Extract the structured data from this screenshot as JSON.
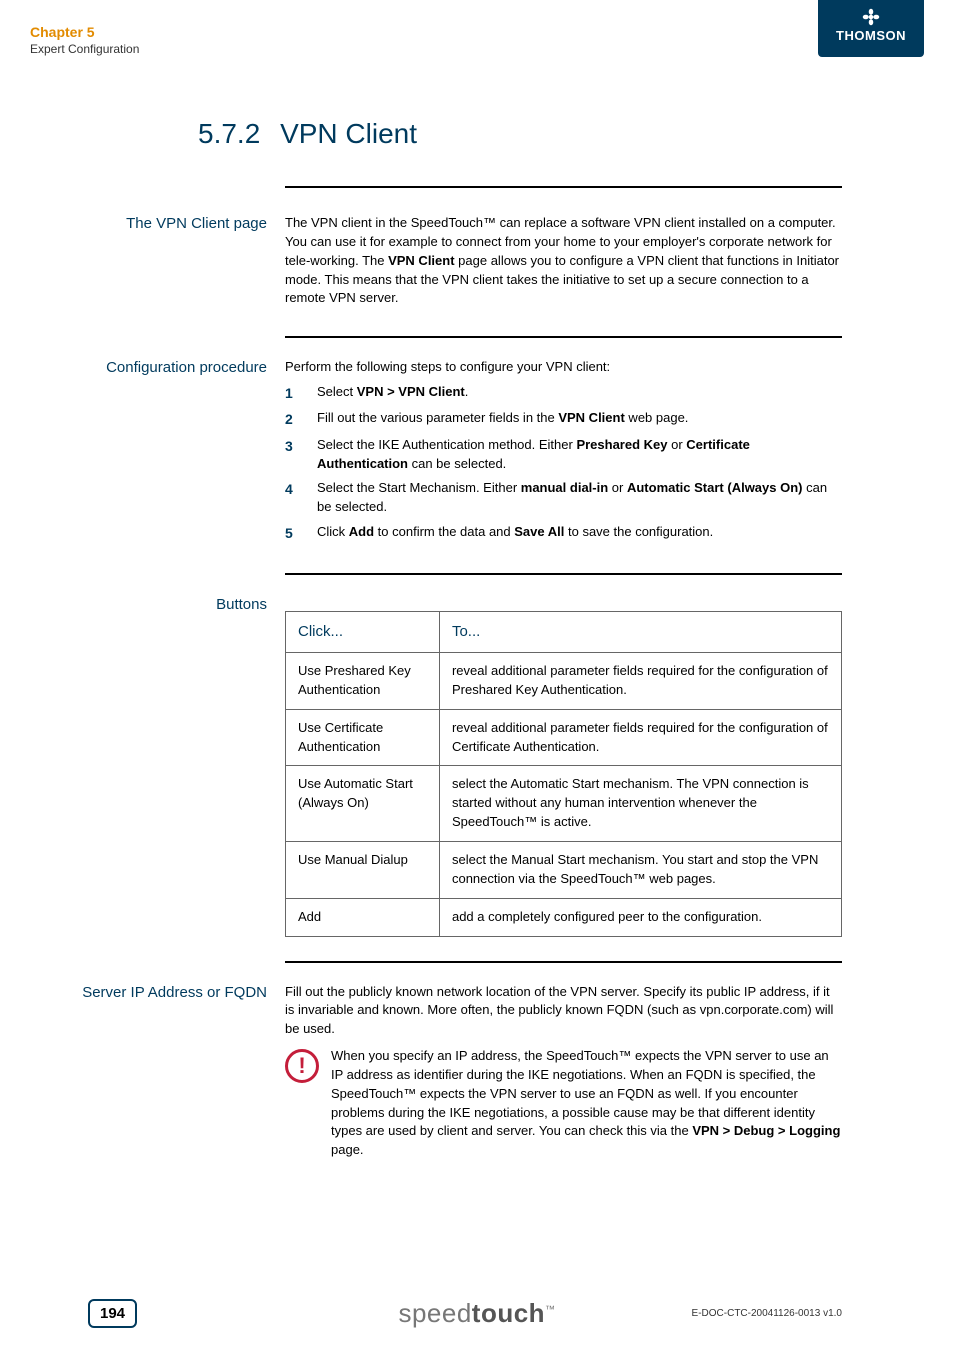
{
  "header": {
    "chapter": "Chapter 5",
    "subtitle": "Expert Configuration",
    "brand": "THOMSON"
  },
  "title": {
    "number": "5.7.2",
    "text": "VPN Client"
  },
  "sections": {
    "vpn_page": {
      "label": "The VPN Client page",
      "para_pre": "The VPN client in the SpeedTouch™ can replace a software VPN client installed on a computer. You can use it for example to connect from your home to your employer's corporate network for tele-working. The ",
      "bold1": "VPN Client",
      "para_post": " page allows you to configure a VPN client that functions in Initiator mode. This means that the VPN client takes the initiative to set up a secure connection to a remote VPN server."
    },
    "config": {
      "label": "Configuration procedure",
      "intro": "Perform the following steps to configure your VPN client:",
      "steps": [
        {
          "n": "1",
          "pre": "Select ",
          "b1": "VPN > VPN Client",
          "post": "."
        },
        {
          "n": "2",
          "pre": "Fill out the various parameter fields in the ",
          "b1": "VPN Client",
          "post": " web page."
        },
        {
          "n": "3",
          "pre": "Select the IKE Authentication method. Either ",
          "b1": "Preshared Key",
          "mid": " or ",
          "b2": "Certificate Authentication",
          "post": " can be selected."
        },
        {
          "n": "4",
          "pre": "Select the Start Mechanism. Either ",
          "b1": "manual dial-in",
          "mid": " or ",
          "b2": "Automatic Start (Always On)",
          "post": " can be selected."
        },
        {
          "n": "5",
          "pre": "Click ",
          "b1": "Add",
          "mid": " to confirm the data and ",
          "b2": "Save All",
          "post": " to save the configuration."
        }
      ]
    },
    "buttons": {
      "label": "Buttons",
      "table": {
        "h1": "Click...",
        "h2": "To...",
        "rows": [
          {
            "c1": "Use Preshared Key Authentication",
            "c2": "reveal additional parameter fields required for the configuration of Preshared Key Authentication."
          },
          {
            "c1": "Use Certificate Authentication",
            "c2": "reveal additional parameter fields required for the configuration of Certificate Authentication."
          },
          {
            "c1": "Use Automatic Start (Always On)",
            "c2": "select the Automatic Start mechanism. The VPN connection is started without any human intervention whenever the SpeedTouch™ is active."
          },
          {
            "c1": "Use Manual Dialup",
            "c2": "select the Manual Start mechanism. You start and stop the VPN connection via the SpeedTouch™ web pages."
          },
          {
            "c1": "Add",
            "c2": "add a completely configured peer to the configuration."
          }
        ]
      }
    },
    "server": {
      "label": "Server IP Address or FQDN",
      "para": "Fill out the publicly known network location of the VPN server. Specify its public IP address, if it is invariable and known. More often, the publicly known FQDN (such as vpn.corporate.com) will be used.",
      "note_pre": "When you specify an IP address, the SpeedTouch™ expects the VPN server to use an IP address as identifier during the IKE negotiations. When an FQDN is specified, the SpeedTouch™ expects the VPN server to use an FQDN as well. If you encounter problems during the IKE negotiations, a possible cause may be that different identity types are used by client and server. You can check this via the ",
      "note_bold": "VPN > Debug > Logging",
      "note_post": " page."
    }
  },
  "footer": {
    "page": "194",
    "brand_light": "speed",
    "brand_bold": "touch",
    "tm": "™",
    "docid": "E-DOC-CTC-20041126-0013 v1.0"
  }
}
